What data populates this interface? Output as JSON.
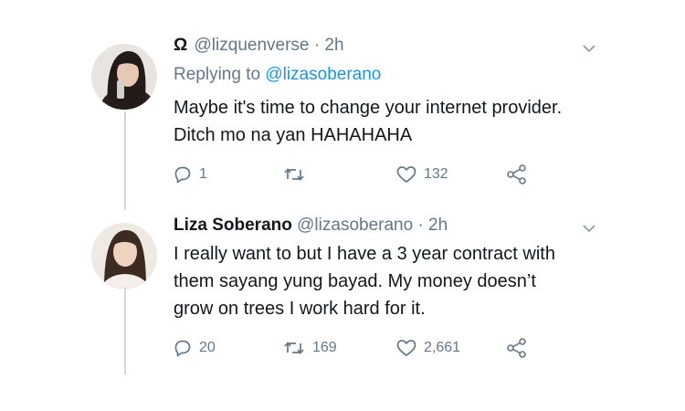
{
  "tweets": [
    {
      "emblem": "Ω",
      "display_name": "",
      "handle": "@lizquenverse",
      "time": "· 2h",
      "replying_prefix": "Replying to",
      "replying_to": "@lizasoberano",
      "body_lines": [
        "Maybe it's time to change your internet provider.",
        "Ditch mo na yan HAHAHAHA"
      ],
      "replies": "1",
      "retweets": "",
      "likes": "132",
      "icons": [
        "reply-icon",
        "retweet-icon",
        "like-icon",
        "share-icon",
        "chevron-down-icon"
      ]
    },
    {
      "emblem": "",
      "display_name": "Liza Soberano",
      "handle": "@lizasoberano",
      "time": "· 2h",
      "body_lines": [
        "I really want to but I have a 3 year contract with",
        "them sayang yung bayad. My money doesn’t",
        "grow on trees I work hard for it."
      ],
      "replies": "20",
      "retweets": "169",
      "likes": "2,661",
      "icons": [
        "reply-icon",
        "retweet-icon",
        "like-icon",
        "share-icon",
        "chevron-down-icon"
      ]
    }
  ],
  "colors": {
    "text": "#14171a",
    "muted": "#657786",
    "link": "#1b95e0",
    "thread_line": "#d2d6da"
  }
}
